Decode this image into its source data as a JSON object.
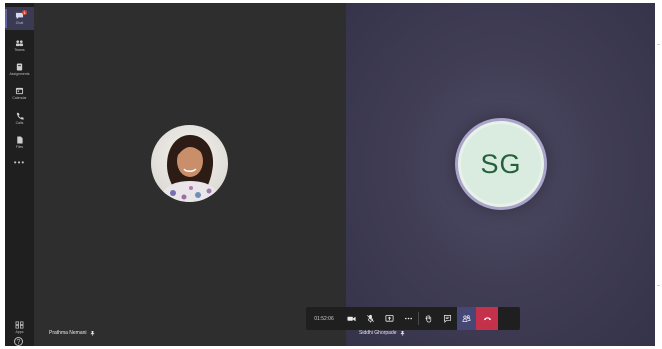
{
  "rail": {
    "items": [
      {
        "label": "Chat",
        "icon": "chat-icon",
        "badge": "1"
      },
      {
        "label": "Teams",
        "icon": "teams-icon"
      },
      {
        "label": "Assignments",
        "icon": "assignments-icon"
      },
      {
        "label": "Calendar",
        "icon": "calendar-icon"
      },
      {
        "label": "Calls",
        "icon": "calls-icon"
      },
      {
        "label": "Files",
        "icon": "files-icon"
      }
    ],
    "more": "•••",
    "apps_label": "Apps",
    "help": "?"
  },
  "participants": [
    {
      "name": "Prathma Nemani",
      "avatar": "photo"
    },
    {
      "name": "Siddhi Ghorpade",
      "initials": "SG",
      "avatar_color": "#d9ecdf",
      "initials_color": "#24613a"
    }
  ],
  "controls": {
    "timer": "01:52:06",
    "buttons": [
      "video-icon",
      "mic-off-icon",
      "share-screen-icon",
      "more-options-icon",
      "raise-hand-icon",
      "chat-icon",
      "participants-icon",
      "hang-up-icon"
    ],
    "accent": "#464775",
    "hangup_color": "#c4314b"
  }
}
